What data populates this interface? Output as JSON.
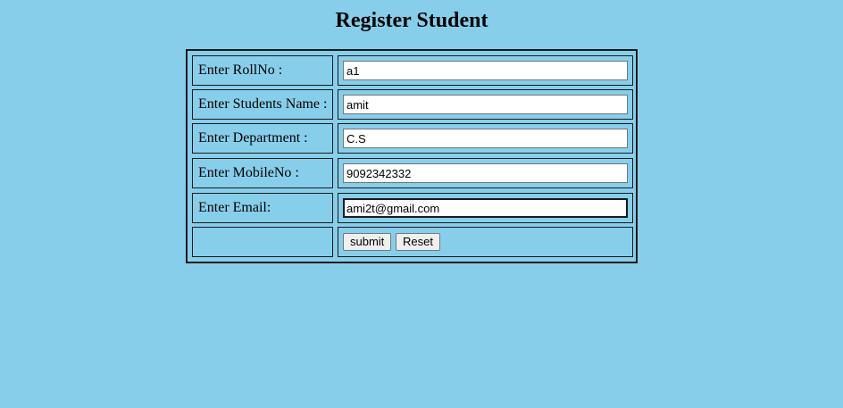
{
  "page": {
    "title": "Register Student"
  },
  "form": {
    "rows": [
      {
        "label": "Enter RollNo :",
        "value": "a1"
      },
      {
        "label": "Enter Students Name :",
        "value": "amit"
      },
      {
        "label": "Enter Department :",
        "value": "C.S"
      },
      {
        "label": "Enter MobileNo :",
        "value": "9092342332"
      },
      {
        "label": "Enter Email:",
        "value": "ami2t@gmail.com"
      }
    ],
    "submit_label": "submit",
    "reset_label": "Reset"
  },
  "colors": {
    "background": "#87ceeb",
    "border": "#1a1a1a",
    "input_background": "#ffffff",
    "button_background": "#efefef"
  }
}
